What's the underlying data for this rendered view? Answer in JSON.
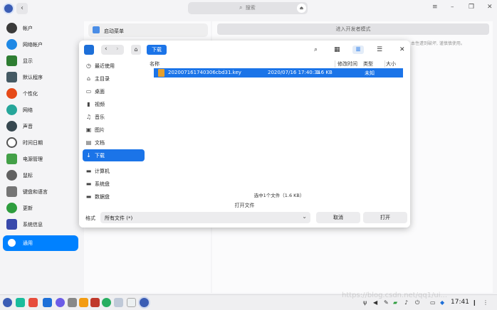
{
  "header": {
    "back": "‹",
    "search_placeholder": "搜索",
    "voice": "⏏",
    "menu": "≡",
    "minimize": "–",
    "restore": "❐",
    "close": "✕"
  },
  "sidebar": {
    "items": [
      {
        "label": "帐户",
        "color": "#3a3a3a"
      },
      {
        "label": "网络帐户",
        "color": "#1e88e5"
      },
      {
        "label": "显示",
        "color": "#2e7d32"
      },
      {
        "label": "默认程序",
        "color": "#455a64"
      },
      {
        "label": "个性化",
        "color": "#e64a19"
      },
      {
        "label": "网络",
        "color": "#26a69a"
      },
      {
        "label": "声音",
        "color": "#37474f"
      },
      {
        "label": "时间日期",
        "color": "#555555"
      },
      {
        "label": "电源管理",
        "color": "#43a047"
      },
      {
        "label": "鼠标",
        "color": "#616161"
      },
      {
        "label": "键盘和语言",
        "color": "#757575"
      },
      {
        "label": "更新",
        "color": "#2e9d3e"
      },
      {
        "label": "系统信息",
        "color": "#3949ab"
      },
      {
        "label": "通用",
        "color": "#ffffff"
      }
    ]
  },
  "main": {
    "startup_menu": "启动菜单",
    "developer_mode_button": "进入开发者模式",
    "bg_text": "本性遭到破坏, 谨慎慎使用。"
  },
  "dialog": {
    "breadcrumb": "下载",
    "sidebar": [
      {
        "icon": "◷",
        "label": "最近使用"
      },
      {
        "icon": "⌂",
        "label": "主目录"
      },
      {
        "icon": "▭",
        "label": "桌面"
      },
      {
        "icon": "▮",
        "label": "视频"
      },
      {
        "icon": "♫",
        "label": "音乐"
      },
      {
        "icon": "▣",
        "label": "图片"
      },
      {
        "icon": "▤",
        "label": "文档"
      },
      {
        "icon": "↓",
        "label": "下载"
      },
      {
        "icon": "▬",
        "label": "计算机"
      },
      {
        "icon": "▬",
        "label": "系统盘"
      },
      {
        "icon": "▬",
        "label": "数据盘"
      }
    ],
    "columns": {
      "name": "名称",
      "modified": "修改时间",
      "size": "大小",
      "type": "类型"
    },
    "files": [
      {
        "name": "20200716174030​6cbd31.key",
        "modified": "2020/07/16 17:40:34",
        "size": "1.6 KB",
        "type": "未知"
      }
    ],
    "status": "选中1个文件（1.6 KB）",
    "title": "打开文件",
    "filetype_label": "格式",
    "filetype_value": "所有文件 (*)",
    "cancel": "取消",
    "open": "打开"
  },
  "taskbar": {
    "clock": "17:41",
    "watermark": "https://blog.csdn.net/qq1/ui..."
  }
}
